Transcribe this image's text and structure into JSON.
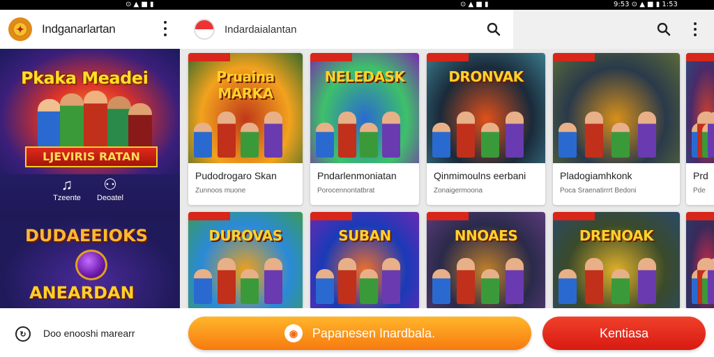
{
  "status_bar": {
    "left_glyphs": "⊙ ▲ ■ ▮",
    "mid_glyphs": "⊙ ▲ ■ ▮",
    "right_text": "9:53 ⊙ ▲ ■ ▮ 1:53"
  },
  "sidebar": {
    "app_title": "Indganarlartan",
    "logo_glyph": "✦",
    "banner_top": {
      "title": "Pkaka Meadei",
      "ribbon": "LJEVIRIS RATAN"
    },
    "quick_actions": [
      {
        "label": "Tzeente",
        "icon": "music-note-icon",
        "glyph": "♫"
      },
      {
        "label": "Deoatel",
        "icon": "gamepad-icon",
        "glyph": "⚇"
      }
    ],
    "banner_bottom": {
      "title": "DUDAEEIOKS",
      "subtitle": "ANEARDAN"
    }
  },
  "header": {
    "search_text": "Indardaialantan",
    "search_icon": "search-icon"
  },
  "games": [
    {
      "art_title": "Pruaina MARKA",
      "title": "Pudodrogaro Skan",
      "subtitle": "Zunnoos muone",
      "colors": [
        "#f2a21e",
        "#c0391a",
        "#3a6a2a"
      ]
    },
    {
      "art_title": "NELEDASK",
      "title": "Pndarlenmoniatan",
      "subtitle": "Porocennontatbrat",
      "colors": [
        "#3ec06a",
        "#2a6ad0",
        "#7a2ab0"
      ]
    },
    {
      "art_title": "DRONVAK",
      "title": "Qinmimoulns eerbani",
      "subtitle": "Zonaigermoona",
      "colors": [
        "#1a2a3a",
        "#e0501a",
        "#3a7a8a"
      ]
    },
    {
      "art_title": "",
      "title": "Pladogiamhkonk",
      "subtitle": "Poca Sraenatirrrt Bedoni",
      "colors": [
        "#2a3a4a",
        "#d8901a",
        "#5a6a3a"
      ]
    },
    {
      "art_title": "",
      "title": "Prd",
      "subtitle": "Pde",
      "colors": [
        "#4a2a6a",
        "#d0402a",
        "#2a4a7a"
      ]
    },
    {
      "art_title": "DUROVAS",
      "title": "",
      "subtitle": "",
      "colors": [
        "#2a8ad8",
        "#f0a01a",
        "#3a9a5a"
      ]
    },
    {
      "art_title": "SUBAN",
      "title": "",
      "subtitle": "",
      "colors": [
        "#1a3ab8",
        "#f0702a",
        "#6a2ab0"
      ]
    },
    {
      "art_title": "NNOAES",
      "title": "",
      "subtitle": "",
      "colors": [
        "#2a2a4a",
        "#c0802a",
        "#5a3a7a"
      ]
    },
    {
      "art_title": "DRENOAK",
      "title": "",
      "subtitle": "",
      "colors": [
        "#3a4a2a",
        "#e0b02a",
        "#2a4a6a"
      ]
    },
    {
      "art_title": "",
      "title": "",
      "subtitle": "",
      "colors": [
        "#3a2a5a",
        "#d02a4a",
        "#2a3a6a"
      ]
    }
  ],
  "footer": {
    "left_text": "Doo enooshi marearr",
    "left_icon": "refresh-icon",
    "left_glyph": "↻",
    "primary_label": "Papanesen Inardbala.",
    "primary_glyph": "◉",
    "secondary_label": "Kentiasa"
  },
  "palette": {
    "accent_orange": "#f77a10",
    "accent_red": "#d81a12",
    "sidebar_bg": "#1b1a5e"
  }
}
